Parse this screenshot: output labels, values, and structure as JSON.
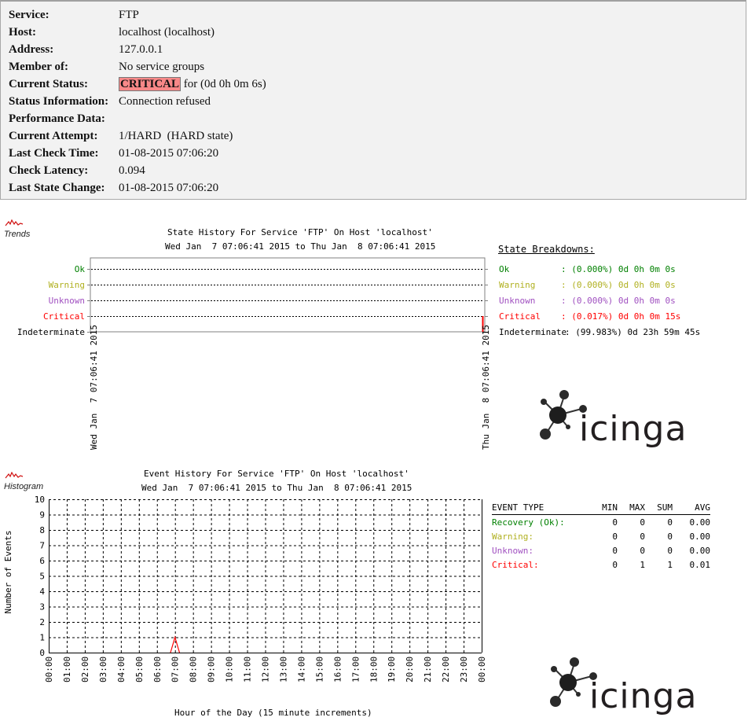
{
  "service_info": {
    "rows": [
      {
        "label": "Service:",
        "value": "FTP"
      },
      {
        "label": "Host:",
        "value": "localhost (localhost)"
      },
      {
        "label": "Address:",
        "value": "127.0.0.1"
      },
      {
        "label": "Member of:",
        "value": "No service groups"
      },
      {
        "label": "Current Status:",
        "status_badge": "CRITICAL",
        "value": " for (0d 0h 0m 6s)"
      },
      {
        "label": "Status Information:",
        "value": "Connection refused"
      },
      {
        "label": "Performance Data:",
        "value": ""
      },
      {
        "label": "Current Attempt:",
        "value": "1/HARD  (HARD state)"
      },
      {
        "label": "Last Check Time:",
        "value": "01-08-2015 07:06:20"
      },
      {
        "label": "Check Latency:",
        "value": "0.094"
      },
      {
        "label": "Last State Change:",
        "value": "01-08-2015 07:06:20"
      }
    ]
  },
  "trends": {
    "icon_label": "Trends",
    "title": "State History For Service 'FTP' On Host 'localhost'",
    "subtitle": "Wed Jan  7 07:06:41 2015 to Thu Jan  8 07:06:41 2015",
    "x_start_label": "Wed Jan  7 07:06:41 2015",
    "x_end_label": "Thu Jan  8 07:06:41 2015",
    "breakdown_title": "State Breakdowns:",
    "states": [
      {
        "name": "Ok",
        "color": "#008000",
        "breakdown": ": (0.000%) 0d 0h 0m 0s"
      },
      {
        "name": "Warning",
        "color": "#b0b020",
        "breakdown": ": (0.000%) 0d 0h 0m 0s"
      },
      {
        "name": "Unknown",
        "color": "#a050c0",
        "breakdown": ": (0.000%) 0d 0h 0m 0s"
      },
      {
        "name": "Critical",
        "color": "#ff0000",
        "breakdown": ": (0.017%) 0d 0h 0m 15s"
      },
      {
        "name": "Indeterminate",
        "color": "#000000",
        "breakdown": ": (99.983%) 0d 23h 59m 45s"
      }
    ]
  },
  "histogram": {
    "icon_label": "Histogram",
    "title": "Event History For Service 'FTP' On Host 'localhost'",
    "subtitle": "Wed Jan  7 07:06:41 2015 to Thu Jan  8 07:06:41 2015",
    "event_table": {
      "headers": [
        "EVENT TYPE",
        "MIN",
        "MAX",
        "SUM",
        "AVG"
      ],
      "rows": [
        {
          "type": "Recovery (Ok):",
          "color": "#008000",
          "min": "0",
          "max": "0",
          "sum": "0",
          "avg": "0.00"
        },
        {
          "type": "Warning:",
          "color": "#b0b020",
          "min": "0",
          "max": "0",
          "sum": "0",
          "avg": "0.00"
        },
        {
          "type": "Unknown:",
          "color": "#a050c0",
          "min": "0",
          "max": "0",
          "sum": "0",
          "avg": "0.00"
        },
        {
          "type": "Critical:",
          "color": "#ff0000",
          "min": "0",
          "max": "1",
          "sum": "1",
          "avg": "0.01"
        }
      ]
    }
  },
  "logo_text": "icinga",
  "chart_data": [
    {
      "type": "line",
      "title": "State History For Service 'FTP' On Host 'localhost'",
      "subtitle": "Wed Jan  7 07:06:41 2015 to Thu Jan  8 07:06:41 2015",
      "y_categories": [
        "Ok",
        "Warning",
        "Unknown",
        "Critical",
        "Indeterminate"
      ],
      "x_range": [
        "Wed Jan  7 07:06:41 2015",
        "Thu Jan  8 07:06:41 2015"
      ],
      "segments": [
        {
          "state": "Indeterminate",
          "fraction_start": 0.0,
          "fraction_end": 0.99983
        },
        {
          "state": "Critical",
          "fraction_start": 0.99983,
          "fraction_end": 1.0
        }
      ]
    },
    {
      "type": "line",
      "title": "Event History For Service 'FTP' On Host 'localhost'",
      "subtitle": "Wed Jan  7 07:06:41 2015 to Thu Jan  8 07:06:41 2015",
      "xlabel": "Hour of the Day (15 minute increments)",
      "ylabel": "Number of Events",
      "ylim": [
        0,
        10
      ],
      "y_ticks": [
        "0",
        "1",
        "2",
        "3",
        "4",
        "5",
        "6",
        "7",
        "8",
        "9",
        "10"
      ],
      "x_ticks": [
        "00:00",
        "01:00",
        "02:00",
        "03:00",
        "04:00",
        "05:00",
        "06:00",
        "07:00",
        "08:00",
        "09:00",
        "10:00",
        "11:00",
        "12:00",
        "13:00",
        "14:00",
        "15:00",
        "16:00",
        "17:00",
        "18:00",
        "19:00",
        "20:00",
        "21:00",
        "22:00",
        "23:00",
        "00:00"
      ],
      "grid": true,
      "series": [
        {
          "name": "Recovery (Ok)",
          "color": "#008000",
          "values_by_hour": {}
        },
        {
          "name": "Warning",
          "color": "#b0b020",
          "values_by_hour": {}
        },
        {
          "name": "Unknown",
          "color": "#a050c0",
          "values_by_hour": {}
        },
        {
          "name": "Critical",
          "color": "#ff0000",
          "points": [
            {
              "x": "07:00",
              "y": 1
            }
          ]
        }
      ]
    }
  ]
}
